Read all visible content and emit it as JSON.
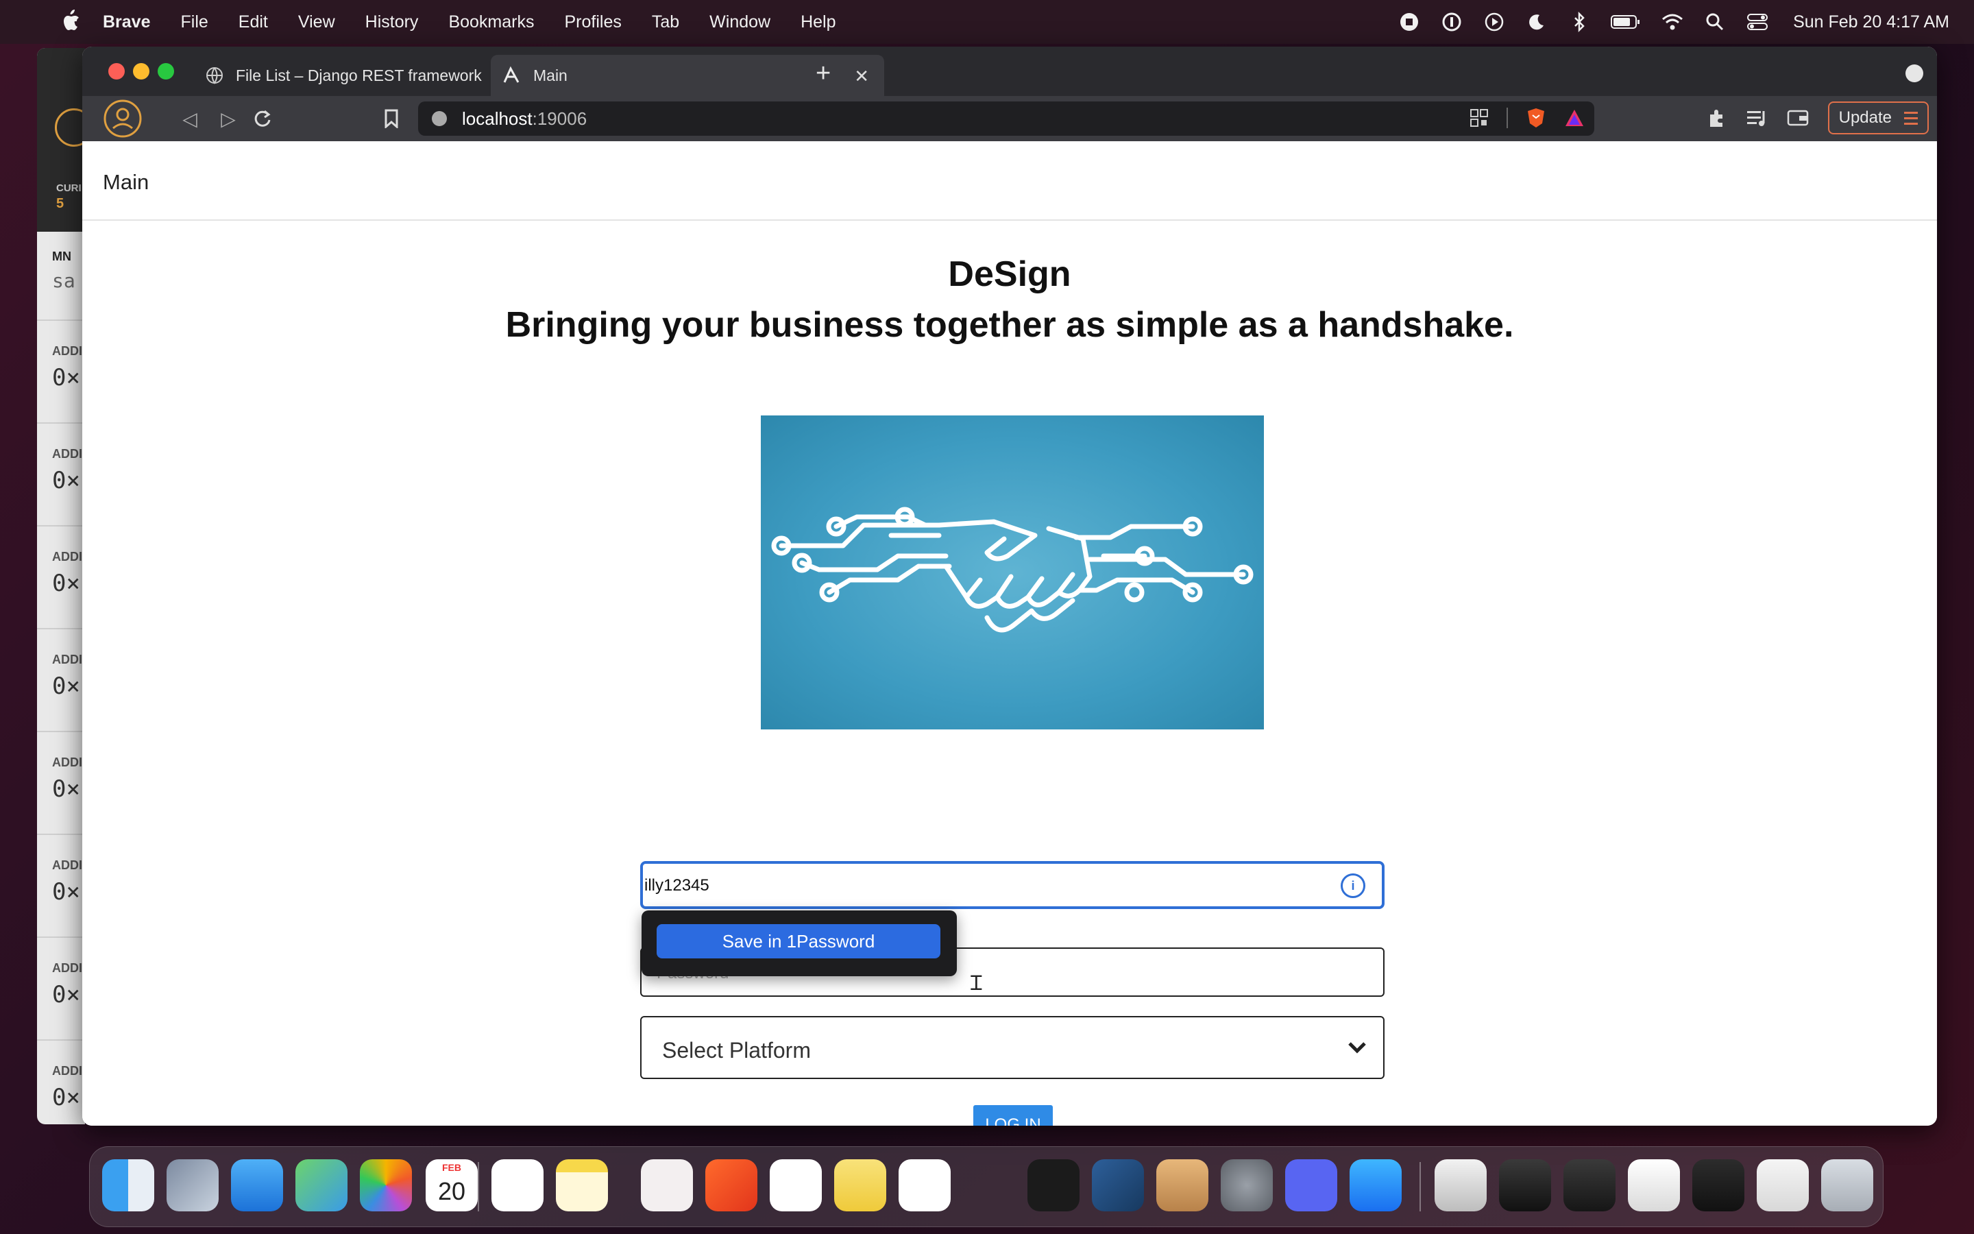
{
  "menubar": {
    "app_name": "Brave",
    "menus": [
      "File",
      "Edit",
      "View",
      "History",
      "Bookmarks",
      "Profiles",
      "Tab",
      "Window",
      "Help"
    ],
    "clock": "Sun Feb 20  4:17 AM"
  },
  "background_app": {
    "top_label": "CURI",
    "top_value": "5",
    "header": "MN",
    "header_value": "sa",
    "row_label": "ADDI",
    "row_value": "0×",
    "rows": 8
  },
  "browser": {
    "tabs": [
      {
        "title": "File List – Django REST framework",
        "active": false
      },
      {
        "title": "Main",
        "active": true
      }
    ],
    "url_host": "localhost",
    "url_port": ":19006",
    "update_label": "Update"
  },
  "page": {
    "nav_title": "Main",
    "title": "DeSign",
    "subtitle": "Bringing your business together as simple as a handshake.",
    "username_value": "illy12345",
    "password_placeholder": "Password",
    "platform_label": "Select Platform",
    "login_label": "LOG IN",
    "onepassword_save_label": "Save in 1Password"
  },
  "dock": {
    "calendar_month": "FEB",
    "calendar_day": "20"
  },
  "colors": {
    "accent_blue": "#2f6fd6",
    "login_button": "#2f8be6",
    "hero_bg": "#3d9bc1",
    "update_border": "#e0704a"
  }
}
